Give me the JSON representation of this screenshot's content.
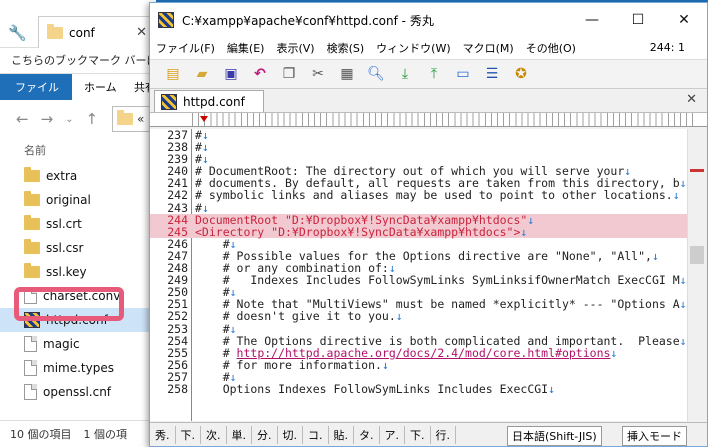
{
  "explorer": {
    "tab_title": "conf",
    "bookmarks_text": "こちらのブックマーク バーにブッ",
    "ribbon": {
      "file": "ファイル",
      "home": "ホーム",
      "share": "共有"
    },
    "address_text": "«",
    "column_header": "名前",
    "items": [
      {
        "name": "extra",
        "type": "folder"
      },
      {
        "name": "original",
        "type": "folder"
      },
      {
        "name": "ssl.crt",
        "type": "folder"
      },
      {
        "name": "ssl.csr",
        "type": "folder"
      },
      {
        "name": "ssl.key",
        "type": "folder"
      },
      {
        "name": "charset.conv",
        "type": "file"
      },
      {
        "name": "httpd.conf",
        "type": "hidemaru",
        "selected": true
      },
      {
        "name": "magic",
        "type": "file"
      },
      {
        "name": "mime.types",
        "type": "file"
      },
      {
        "name": "openssl.cnf",
        "type": "file"
      }
    ],
    "status": {
      "count": "10 個の項目",
      "selected": "1 個の項"
    }
  },
  "editor": {
    "window_title": "C:¥xampp¥apache¥conf¥httpd.conf - 秀丸",
    "menus": [
      "ファイル(F)",
      "編集(E)",
      "表示(V)",
      "検索(S)",
      "ウィンドウ(W)",
      "マクロ(M)",
      "その他(O)"
    ],
    "cursor_pos": "244: 1",
    "tab_label": "httpd.conf",
    "lines": [
      {
        "n": "237",
        "t": "#"
      },
      {
        "n": "238",
        "t": "#"
      },
      {
        "n": "239",
        "t": "#"
      },
      {
        "n": "240",
        "t": "# DocumentRoot: The directory out of which you will serve your"
      },
      {
        "n": "241",
        "t": "# documents. By default, all requests are taken from this directory, b"
      },
      {
        "n": "242",
        "t": "# symbolic links and aliases may be used to point to other locations."
      },
      {
        "n": "243",
        "t": "#"
      },
      {
        "n": "244",
        "t": "DocumentRoot \"D:¥Dropbox¥!SyncData¥xampp¥htdocs\"",
        "hl": true
      },
      {
        "n": "245",
        "t": "<Directory \"D:¥Dropbox¥!SyncData¥xampp¥htdocs\">",
        "hl": true
      },
      {
        "n": "246",
        "t": "    #"
      },
      {
        "n": "247",
        "t": "    # Possible values for the Options directive are \"None\", \"All\","
      },
      {
        "n": "248",
        "t": "    # or any combination of:"
      },
      {
        "n": "249",
        "t": "    #   Indexes Includes FollowSymLinks SymLinksifOwnerMatch ExecCGI M"
      },
      {
        "n": "250",
        "t": "    #"
      },
      {
        "n": "251",
        "t": "    # Note that \"MultiViews\" must be named *explicitly* --- \"Options A"
      },
      {
        "n": "252",
        "t": "    # doesn't give it to you."
      },
      {
        "n": "253",
        "t": "    #"
      },
      {
        "n": "254",
        "t": "    # The Options directive is both complicated and important.  Please"
      },
      {
        "n": "255",
        "t": "    # ",
        "link": "http://httpd.apache.org/docs/2.4/mod/core.html#options"
      },
      {
        "n": "256",
        "t": "    # for more information."
      },
      {
        "n": "257",
        "t": "    #"
      },
      {
        "n": "258",
        "t": "    Options Indexes FollowSymLinks Includes ExecCGI"
      }
    ],
    "status": {
      "items": [
        "秀.",
        "下.",
        "次.",
        "単.",
        "分.",
        "切.",
        "コ.",
        "貼.",
        "タ.",
        "ア.",
        "下.",
        "行."
      ],
      "encoding": "日本語(Shift-JIS)",
      "mode": "挿入モード"
    }
  }
}
